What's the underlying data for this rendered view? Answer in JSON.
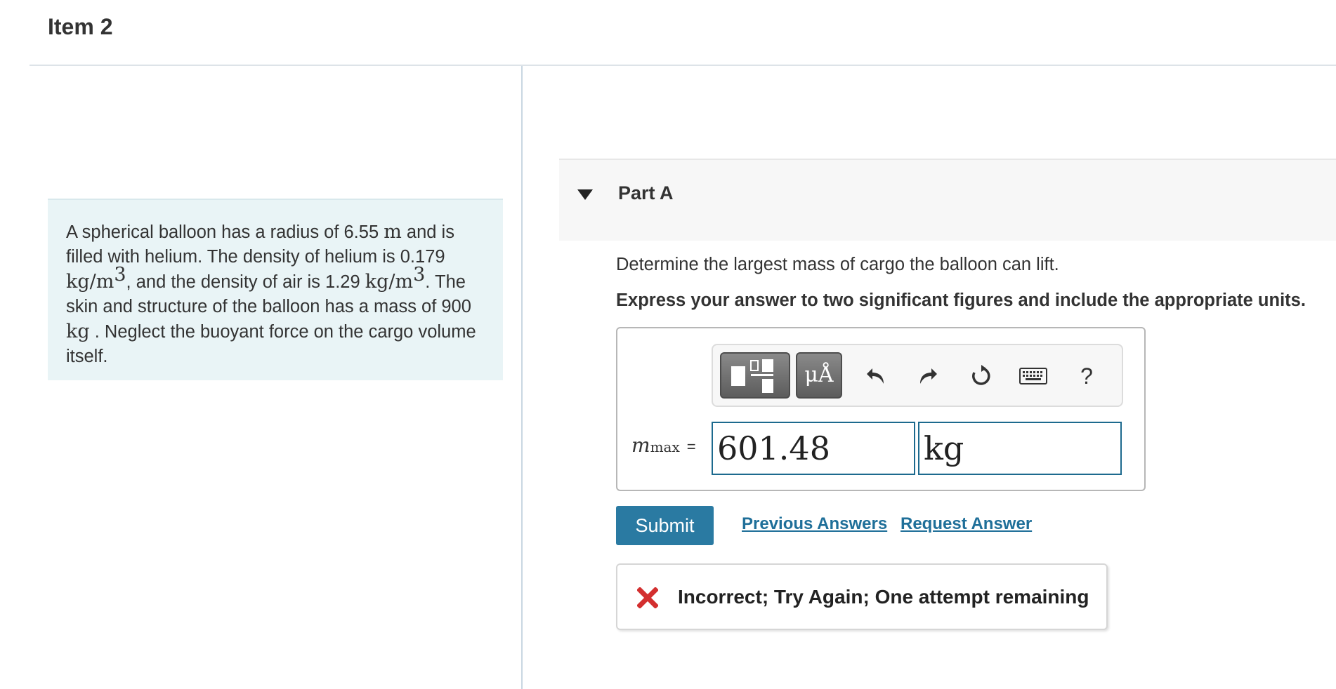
{
  "item": {
    "title": "Item 2"
  },
  "problem": {
    "t1": "A spherical balloon has a radius of 6.55 ",
    "m1": "m",
    "t2": " and is filled with helium. The density of helium is 0.179 ",
    "m2": "kg/m",
    "exp2": "3",
    "t3": ", and the density of air is 1.29 ",
    "m3": "kg/m",
    "exp3": "3",
    "t4": ". The skin and structure of the balloon has a mass of 900 ",
    "m4": "kg",
    "t5": " . Neglect the buoyant force on the cargo volume itself."
  },
  "part": {
    "title": "Part A",
    "question": "Determine the largest mass of cargo the balloon can lift.",
    "instruction": "Express your answer to two significant figures and include the appropriate units."
  },
  "toolbar": {
    "units_label": "μÅ",
    "help_label": "?",
    "icons": [
      "templates-icon",
      "units-icon",
      "undo-icon",
      "redo-icon",
      "reset-icon",
      "keyboard-icon",
      "help-icon"
    ]
  },
  "answer": {
    "variable": "m",
    "subscript": "max",
    "equals": "=",
    "value": "601.48",
    "units": "kg"
  },
  "actions": {
    "submit": "Submit",
    "previous_answers": "Previous Answers",
    "request_answer": "Request Answer"
  },
  "feedback": {
    "message": "Incorrect; Try Again; One attempt remaining",
    "icon": "x-icon"
  },
  "colors": {
    "accent": "#2a7aa2",
    "link": "#1f6f99",
    "error": "#d32f2f",
    "problem_bg": "#e9f4f6"
  }
}
